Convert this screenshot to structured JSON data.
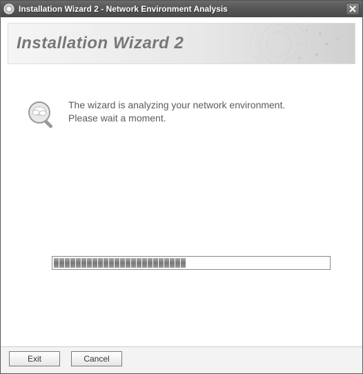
{
  "titlebar": {
    "text": "Installation Wizard 2 - Network Environment Analysis"
  },
  "header": {
    "heading": "Installation Wizard 2"
  },
  "message": {
    "line1": "The wizard is analyzing your network environment.",
    "line2": "Please wait a moment."
  },
  "progress": {
    "percent": 58
  },
  "buttons": {
    "exit": "Exit",
    "cancel": "Cancel"
  },
  "colors": {
    "titlebar_bg": "#555555",
    "heading_color": "#777777",
    "text_color": "#5a5a5a"
  }
}
